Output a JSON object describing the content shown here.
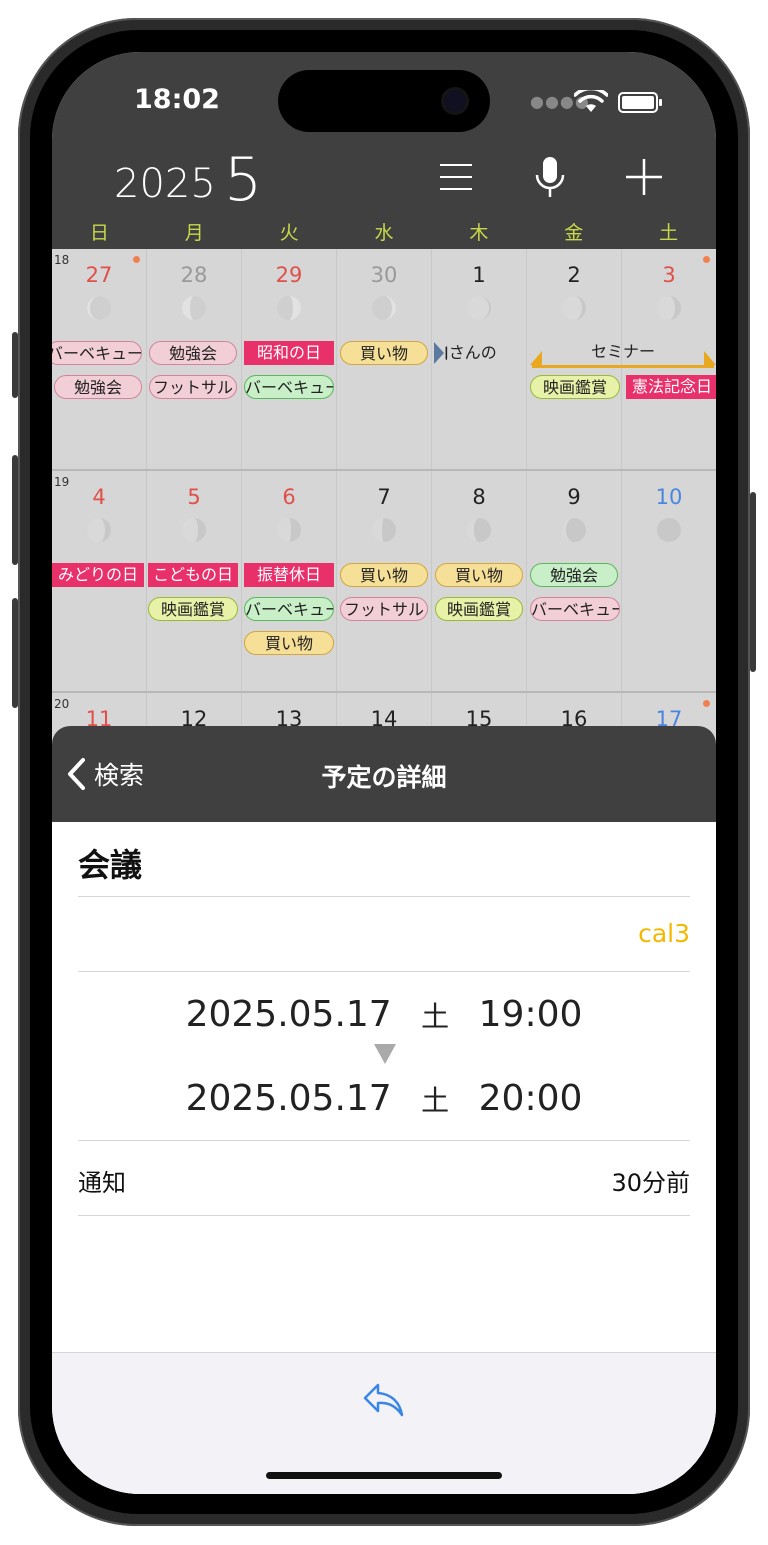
{
  "status": {
    "time": "18:02"
  },
  "header": {
    "year": "2025",
    "month": "5"
  },
  "weekdays": [
    "日",
    "月",
    "火",
    "水",
    "木",
    "金",
    "土"
  ],
  "weeks": [
    {
      "week_no": "18",
      "days": [
        "27",
        "28",
        "29",
        "30",
        "1",
        "2",
        "3"
      ]
    },
    {
      "week_no": "19",
      "days": [
        "4",
        "5",
        "6",
        "7",
        "8",
        "9",
        "10"
      ]
    },
    {
      "week_no": "20",
      "days": [
        "11",
        "12",
        "13",
        "14",
        "15",
        "16",
        "17"
      ]
    }
  ],
  "events": {
    "w1": {
      "sun1": "バーベキュー",
      "sun2": "勉強会",
      "mon1": "勉強会",
      "mon2": "フットサル",
      "tue1": "昭和の日",
      "tue2": "バーベキュー",
      "wed1": "買い物",
      "thu1": "Jさんの",
      "seminar": "セミナー",
      "fri2": "映画鑑賞",
      "sat2": "憲法記念日"
    },
    "w2": {
      "sun1": "みどりの日",
      "mon1": "こどもの日",
      "mon2": "映画鑑賞",
      "tue1": "振替休日",
      "tue2": "バーベキュー",
      "tue3": "買い物",
      "wed1": "買い物",
      "wed2": "フットサル",
      "thu1": "買い物",
      "thu2": "映画鑑賞",
      "fri1": "勉強会",
      "fri2": "バーベキュー"
    }
  },
  "sheet": {
    "back_label": "検索",
    "title": "予定の詳細",
    "event_title": "会議",
    "calendar": "cal3",
    "start_date": "2025.05.17",
    "start_wd": "土",
    "start_time": "19:00",
    "end_date": "2025.05.17",
    "end_wd": "土",
    "end_time": "20:00",
    "alert_label": "通知",
    "alert_value": "30分前"
  },
  "colors": {
    "dark": "#404040",
    "calendar_accent": "#f4b800",
    "share_icon": "#3a86e8"
  }
}
